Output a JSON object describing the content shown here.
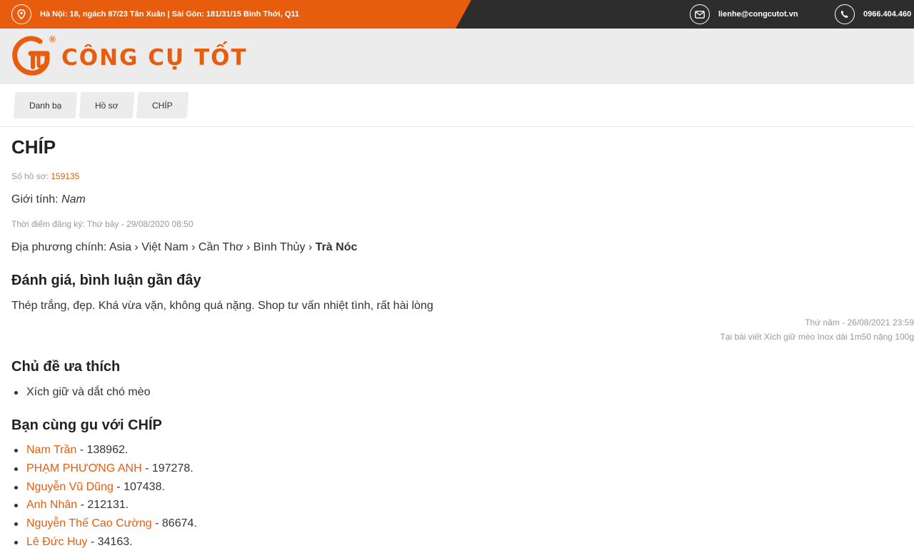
{
  "topbar": {
    "address": "Hà Nội: 18, ngách 87/23 Tân Xuân | Sài Gòn: 181/31/15 Bình Thới, Q11",
    "email": "lienhe@congcutot.vn",
    "phone": "0966.404.460",
    "icons": {
      "address": "location-pin-icon",
      "email": "envelope-icon",
      "phone": "phone-icon"
    }
  },
  "logo": {
    "text": "CÔNG CỤ TỐT",
    "registered": "®"
  },
  "breadcrumb": [
    "Danh bạ",
    "Hồ sơ",
    "CHÍP"
  ],
  "profile": {
    "name": "CHÍP",
    "id_label": "Số hồ sơ:",
    "id_value": "159135",
    "gender_label": "Giới tính:",
    "gender_value": "Nam",
    "registered": "Thời điểm đăng ký: Thứ bảy - 29/08/2020 08:50",
    "region_label": "Địa phương chính:",
    "region_path": "Asia › Việt Nam › Cần Thơ › Bình Thủy ›",
    "region_last": "Trà Nóc"
  },
  "reviews": {
    "heading": "Đánh giá, bình luận gần đây",
    "items": [
      {
        "text": "Thép trắng, đẹp. Khá vừa vặn, không quá nặng. Shop tư vấn nhiệt tình, rất hài lòng",
        "date": "Thứ năm - 26/08/2021 23:59",
        "post": "Tại bài viết Xích giữ mèo Inox dài 1m50 nặng 100g"
      }
    ]
  },
  "topics": {
    "heading": "Chủ đề ưa thích",
    "items": [
      "Xích giữ và dắt chó mèo"
    ]
  },
  "friends": {
    "heading": "Bạn cùng gu với CHÍP",
    "items": [
      {
        "name": "Nam Trần",
        "suffix": " - 138962."
      },
      {
        "name": "PHẠM PHƯƠNG ANH",
        "suffix": " - 197278."
      },
      {
        "name": "Nguyễn Vũ Dũng",
        "suffix": " - 107438."
      },
      {
        "name": "Anh Nhân",
        "suffix": " - 212131."
      },
      {
        "name": "Nguyễn Thế Cao Cường",
        "suffix": " - 86674."
      },
      {
        "name": "Lê Đức Huy",
        "suffix": " - 34163."
      }
    ]
  },
  "colors": {
    "accent": "#e85c0d",
    "dark_bar": "#2d2d2d",
    "header_bg": "#ececec"
  }
}
